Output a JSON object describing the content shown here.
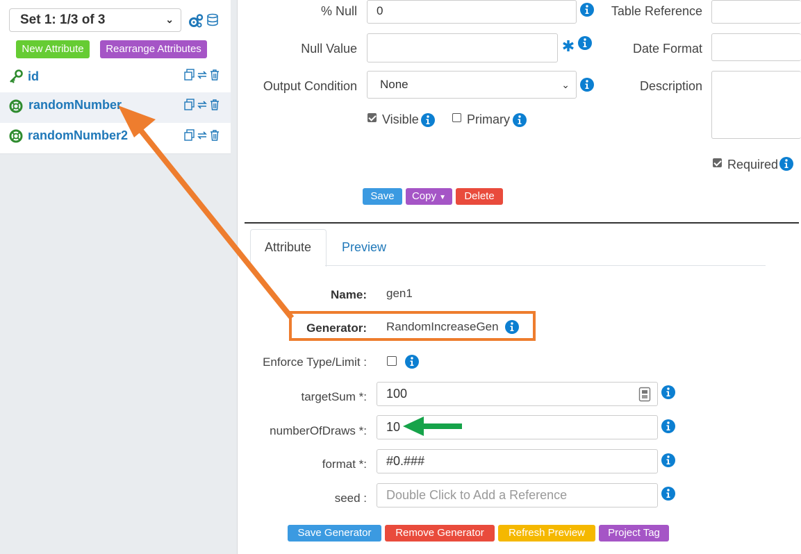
{
  "sidebar": {
    "set_select": "Set 1: 1/3 of 3",
    "icons": [
      "gears-icon",
      "database-icon"
    ],
    "new_attribute_button": "New Attribute",
    "rearrange_button": "Rearrange Attributes",
    "attributes": [
      {
        "name": "id",
        "icon": "key-icon",
        "selected": false
      },
      {
        "name": "randomNumber",
        "icon": "lifebuoy-icon",
        "selected": true
      },
      {
        "name": "randomNumber2",
        "icon": "lifebuoy-icon",
        "selected": false
      }
    ],
    "row_actions": [
      "copy-icon",
      "swap-icon",
      "trash-icon"
    ]
  },
  "form": {
    "null_percent": {
      "label": "% Null",
      "value": "0"
    },
    "null_value": {
      "label": "Null Value",
      "value": ""
    },
    "output_condition": {
      "label": "Output Condition",
      "value": "None"
    },
    "visible": {
      "label": "Visible",
      "checked": true
    },
    "primary": {
      "label": "Primary",
      "checked": false
    },
    "table_reference": {
      "label": "Table Reference",
      "value": ""
    },
    "date_format": {
      "label": "Date Format",
      "value": ""
    },
    "description": {
      "label": "Description",
      "value": ""
    },
    "required": {
      "label": "Required",
      "checked": true
    },
    "save_button": "Save",
    "copy_button": "Copy",
    "delete_button": "Delete"
  },
  "tabs": [
    {
      "label": "Attribute",
      "active": true
    },
    {
      "label": "Preview",
      "active": false
    }
  ],
  "generator": {
    "name_label": "Name:",
    "name_value": "gen1",
    "generator_label": "Generator:",
    "generator_value": "RandomIncreaseGen",
    "enforce_label": "Enforce Type/Limit :",
    "enforce_checked": false,
    "params": [
      {
        "label": "targetSum *:",
        "value": "100",
        "placeholder": ""
      },
      {
        "label": "numberOfDraws *:",
        "value": "10",
        "placeholder": ""
      },
      {
        "label": "format *:",
        "value": "#0.###",
        "placeholder": ""
      },
      {
        "label": "seed :",
        "value": "",
        "placeholder": "Double Click to Add a Reference"
      }
    ],
    "save_generator_button": "Save Generator",
    "remove_generator_button": "Remove Generator",
    "refresh_preview_button": "Refresh Preview",
    "project_tag_button": "Project Tag"
  },
  "colors": {
    "annotation_orange": "#ee7d2e",
    "annotation_green": "#16a34a",
    "link_blue": "#1f78b9",
    "info_blue": "#0c7fd1"
  }
}
